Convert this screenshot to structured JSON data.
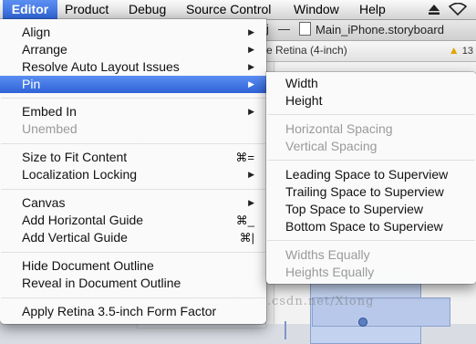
{
  "menubar": {
    "items": [
      "Editor",
      "Product",
      "Debug",
      "Source Control",
      "Window",
      "Help"
    ],
    "icons": [
      "eject-icon",
      "wifi-icon"
    ]
  },
  "background": {
    "breadcrumb_left": "j",
    "breadcrumb_dash": "—",
    "breadcrumb_file": "Main_iPhone.storyboard",
    "subbar_label": "e Retina (4-inch)",
    "warning_count": "13",
    "watermark": "http://blog.csdn.net/Xiong"
  },
  "edit_menu": {
    "items": [
      {
        "label": "Align",
        "submenu": true
      },
      {
        "label": "Arrange",
        "submenu": true
      },
      {
        "label": "Resolve Auto Layout Issues",
        "submenu": true
      },
      {
        "label": "Pin",
        "submenu": true,
        "selected": true
      },
      {
        "label": "Embed In",
        "submenu": true
      },
      {
        "label": "Unembed",
        "disabled": true
      },
      {
        "label": "Size to Fit Content",
        "shortcut": "⌘="
      },
      {
        "label": "Localization Locking",
        "submenu": true
      },
      {
        "label": "Canvas",
        "submenu": true
      },
      {
        "label": "Add Horizontal Guide",
        "shortcut": "⌘_"
      },
      {
        "label": "Add Vertical Guide",
        "shortcut": "⌘|"
      },
      {
        "label": "Hide Document Outline"
      },
      {
        "label": "Reveal in Document Outline"
      },
      {
        "label": "Apply Retina 3.5-inch Form Factor"
      }
    ]
  },
  "pin_menu": {
    "items": [
      {
        "label": "Width"
      },
      {
        "label": "Height"
      },
      {
        "label": "Horizontal Spacing",
        "disabled": true
      },
      {
        "label": "Vertical Spacing",
        "disabled": true
      },
      {
        "label": "Leading Space to Superview"
      },
      {
        "label": "Trailing Space to Superview"
      },
      {
        "label": "Top Space to Superview"
      },
      {
        "label": "Bottom Space to Superview"
      },
      {
        "label": "Widths Equally",
        "disabled": true
      },
      {
        "label": "Heights Equally",
        "disabled": true
      }
    ]
  },
  "colors": {
    "selection": "#2f63d7",
    "disabled_text": "#9a9a9a",
    "warning": "#e0a400"
  }
}
